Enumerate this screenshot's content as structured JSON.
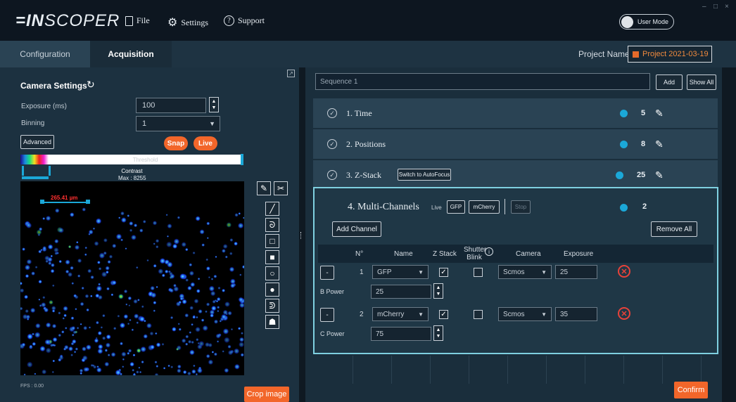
{
  "app": {
    "logo_prefix": "IN",
    "logo_suffix": "SCOPER"
  },
  "menu": {
    "file": "File",
    "settings": "Settings",
    "support": "Support"
  },
  "mode_toggle": {
    "label": "User Mode"
  },
  "window_controls": {
    "min": "–",
    "max": "□",
    "close": "×"
  },
  "tabs": [
    {
      "label": "Configuration"
    },
    {
      "label": "Acquisition"
    }
  ],
  "project": {
    "label": "Project Name",
    "value": "Project 2021-03-19"
  },
  "camera": {
    "title": "Camera Settings",
    "exposure_label": "Exposure (ms)",
    "exposure_value": "100",
    "binning_label": "Binning",
    "binning_value": "1",
    "advanced": "Advanced",
    "snap": "Snap",
    "live": "Live",
    "threshold": "Threshold",
    "contrast": "Contrast",
    "max": "Max : 8255",
    "scale_label": "265.41 µm",
    "fps": "FPS : 0.00",
    "crop": "Crop image"
  },
  "sequence": {
    "name": "Sequence 1",
    "add": "Add",
    "show_all": "Show All",
    "steps": [
      {
        "label": "1.  Time",
        "count": "5"
      },
      {
        "label": "2.  Positions",
        "count": "8"
      },
      {
        "label": "3.  Z-Stack",
        "count": "25",
        "button": "Switch to AutoFocus"
      }
    ],
    "multi": {
      "label": "4.  Multi-Channels",
      "count": "2",
      "live": "Live",
      "gfp": "GFP",
      "mcherry": "mCherry",
      "stop": "Stop",
      "add_channel": "Add Channel",
      "remove_all": "Remove All",
      "headers": {
        "no": "N°",
        "name": "Name",
        "zstack": "Z Stack",
        "shutter": "Shutter Blink",
        "camera": "Camera",
        "exposure": "Exposure"
      },
      "channels": [
        {
          "n": "1",
          "name": "GFP",
          "camera": "Scmos",
          "exposure": "25",
          "power_label": "B Power",
          "power": "25"
        },
        {
          "n": "2",
          "name": "mCherry",
          "camera": "Scmos",
          "exposure": "35",
          "power_label": "C Power",
          "power": "75"
        }
      ],
      "minus": "-"
    },
    "confirm": "Confirm"
  },
  "colors": {
    "accent": "#f2662a",
    "cyan": "#1ba8d8",
    "highlight": "#7fd0e0",
    "delete": "#e8423a"
  }
}
